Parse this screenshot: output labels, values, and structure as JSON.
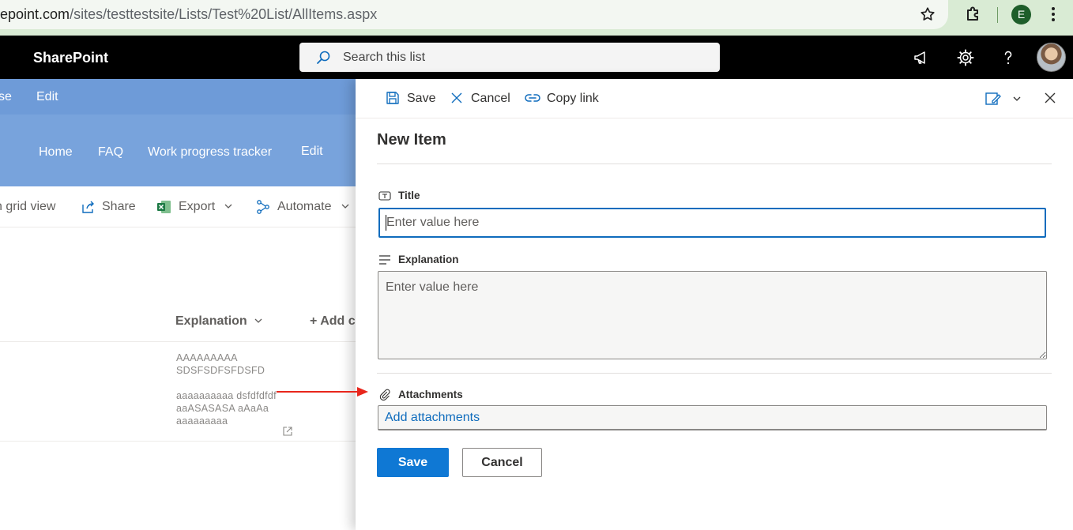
{
  "browser": {
    "url_domain": "epoint.com",
    "url_path": "/sites/testtestsite/Lists/Test%20List/AllItems.aspx",
    "profile_initial": "E"
  },
  "suite": {
    "brand": "SharePoint",
    "search_placeholder": "Search this list"
  },
  "site": {
    "top_nav": [
      "se",
      "Edit"
    ],
    "nav": [
      "Home",
      "FAQ",
      "Work progress tracker",
      "Edit"
    ]
  },
  "commands": {
    "grid_view": "n grid view",
    "share": "Share",
    "export": "Export",
    "automate": "Automate"
  },
  "list": {
    "column_explanation": "Explanation",
    "add_column": "+ Add c",
    "row": {
      "line1": "AAAAAAAAA",
      "line2": "SDSFSDFSFDSFD",
      "line3": "aaaaaaaaaa dsfdfdfdf",
      "line4": "aaASASASA aAaAa",
      "line5": "aaaaaaaaa"
    }
  },
  "panel": {
    "toolbar": {
      "save": "Save",
      "cancel": "Cancel",
      "copy_link": "Copy link"
    },
    "title": "New Item",
    "fields": {
      "title_label": "Title",
      "title_placeholder": "Enter value here",
      "explanation_label": "Explanation",
      "explanation_placeholder": "Enter value here",
      "attachments_label": "Attachments",
      "add_attachments": "Add attachments"
    },
    "buttons": {
      "save": "Save",
      "cancel": "Cancel"
    }
  },
  "colors": {
    "accent": "#0f78d4",
    "site_header": "#78a3dc",
    "annotation_arrow": "#e8261c"
  }
}
